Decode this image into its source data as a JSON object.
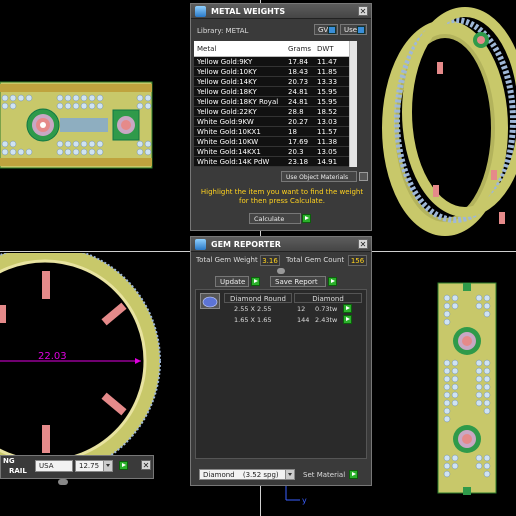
{
  "metal_weights": {
    "title": "METAL WEIGHTS",
    "library_label": "Library: METAL",
    "gv_label": "GV",
    "user_label": "User",
    "columns": [
      "Metal",
      "Grams",
      "DWT"
    ],
    "rows": [
      {
        "metal": "Yellow Gold:9KY",
        "grams": "17.84",
        "dwt": "11.47"
      },
      {
        "metal": "Yellow Gold:10KY",
        "grams": "18.43",
        "dwt": "11.85"
      },
      {
        "metal": "Yellow Gold:14KY",
        "grams": "20.73",
        "dwt": "13.33"
      },
      {
        "metal": "Yellow Gold:18KY",
        "grams": "24.81",
        "dwt": "15.95"
      },
      {
        "metal": "Yellow Gold:18KY Royal",
        "grams": "24.81",
        "dwt": "15.95"
      },
      {
        "metal": "Yellow Gold:22KY",
        "grams": "28.8",
        "dwt": "18.52"
      },
      {
        "metal": "White Gold:9KW",
        "grams": "20.27",
        "dwt": "13.03"
      },
      {
        "metal": "White Gold:10KX1",
        "grams": "18",
        "dwt": "11.57"
      },
      {
        "metal": "White Gold:10KW",
        "grams": "17.69",
        "dwt": "11.38"
      },
      {
        "metal": "White Gold:14KX1",
        "grams": "20.3",
        "dwt": "13.05"
      },
      {
        "metal": "White Gold:14K PdW",
        "grams": "23.18",
        "dwt": "14.91"
      }
    ],
    "use_object_materials": "Use Object Materials",
    "instruction": "Highlight the item you want to find the weight for then press Calculate.",
    "calculate_label": "Calculate"
  },
  "gem_reporter": {
    "title": "GEM REPORTER",
    "total_gem_weight_label": "Total Gem Weight",
    "total_gem_weight_value": "3.16",
    "total_gem_count_label": "Total Gem Count",
    "total_gem_count_value": "156",
    "update_label": "Update",
    "save_report_label": "Save Report",
    "gem_headers": [
      "Diamond Round",
      "Diamond"
    ],
    "gem_rows": [
      {
        "size": "2.55 X 2.55",
        "count": "12",
        "weight": "0.73tw"
      },
      {
        "size": "1.65 X 1.65",
        "count": "144",
        "weight": "2.43tw"
      }
    ],
    "material_select": "Diamond",
    "material_sg": "(3.52 spg)",
    "set_material_label": "Set Material"
  },
  "ring_sizer": {
    "label_line1": "NG",
    "label_line2": "RAIL",
    "standard": "USA",
    "size": "12.75"
  },
  "viewport": {
    "dimension_value": "22.03",
    "axis_y_label": "y"
  }
}
